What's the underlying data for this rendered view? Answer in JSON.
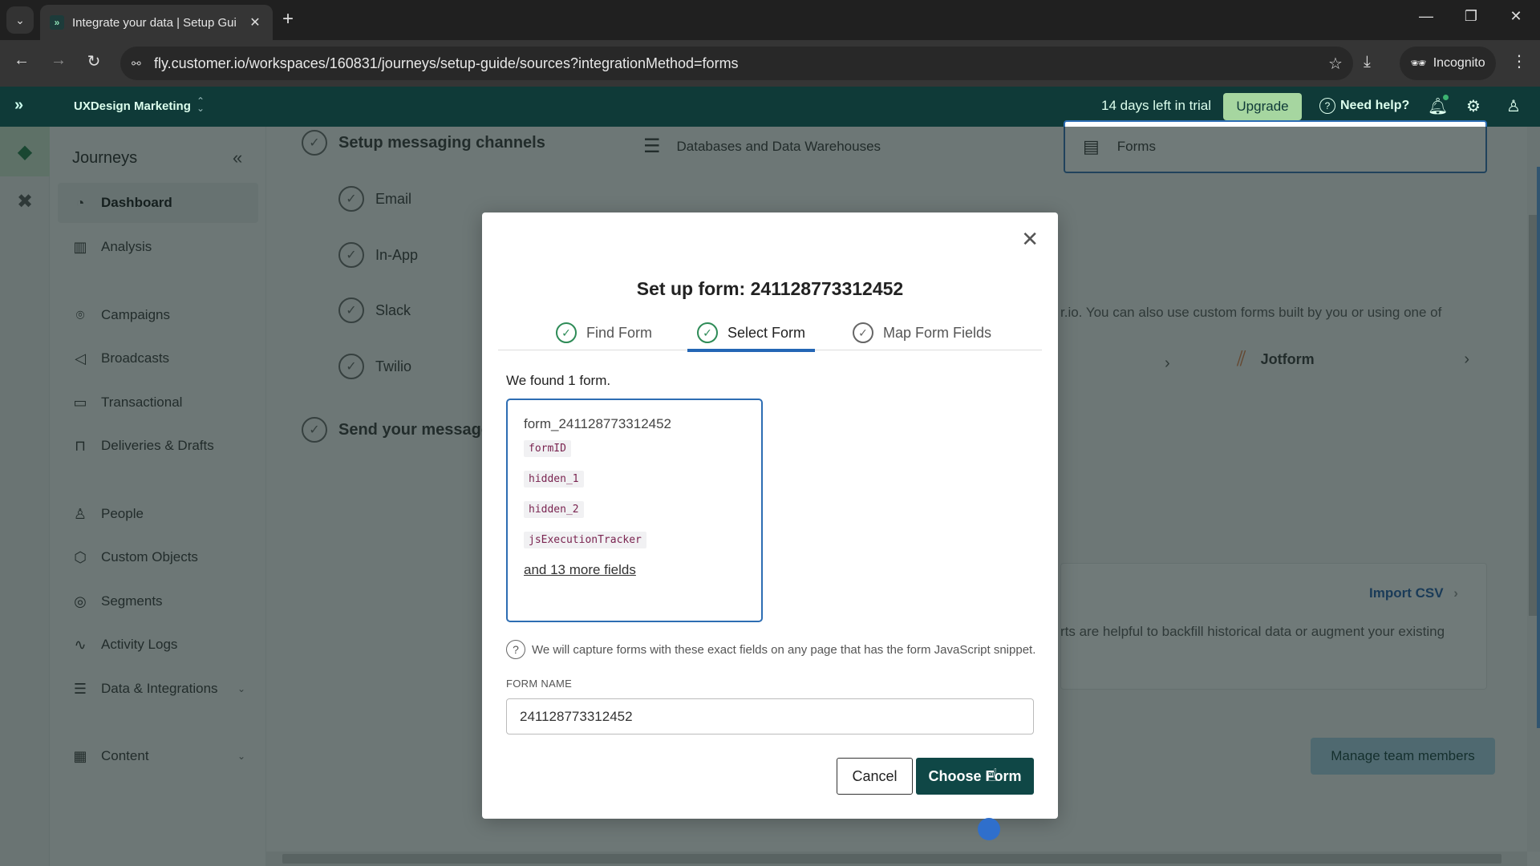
{
  "browser": {
    "tab_title": "Integrate your data | Setup Gui",
    "tab_favicon": "customerio-logo",
    "new_tab": "+",
    "url": "fly.customer.io/workspaces/160831/journeys/setup-guide/sources?integrationMethod=forms",
    "incognito_label": "Incognito",
    "window_controls": {
      "minimize": "—",
      "restore": "❐",
      "close": "✕"
    }
  },
  "topbar": {
    "workspace": "UXDesign Marketing",
    "trial": "14 days left in trial",
    "upgrade": "Upgrade",
    "help": "Need help?"
  },
  "sidebar": {
    "title": "Journeys",
    "items": [
      {
        "label": "Dashboard",
        "icon": "dashboard-icon",
        "glyph": "◔",
        "active": true
      },
      {
        "label": "Analysis",
        "icon": "bar-chart-icon",
        "glyph": "▥"
      },
      {
        "label": "Campaigns",
        "icon": "campaigns-icon",
        "glyph": "⌾"
      },
      {
        "label": "Broadcasts",
        "icon": "megaphone-icon",
        "glyph": "◁"
      },
      {
        "label": "Transactional",
        "icon": "terminal-icon",
        "glyph": "▭"
      },
      {
        "label": "Deliveries & Drafts",
        "icon": "inbox-icon",
        "glyph": "⊓"
      },
      {
        "label": "People",
        "icon": "person-icon",
        "glyph": "♙"
      },
      {
        "label": "Custom Objects",
        "icon": "cube-icon",
        "glyph": "⬡"
      },
      {
        "label": "Segments",
        "icon": "segments-icon",
        "glyph": "◎"
      },
      {
        "label": "Activity Logs",
        "icon": "activity-icon",
        "glyph": "∿"
      },
      {
        "label": "Data & Integrations",
        "icon": "database-icon",
        "glyph": "☰",
        "chevron": "⌄"
      },
      {
        "label": "Content",
        "icon": "layout-icon",
        "glyph": "▦",
        "chevron": "⌄"
      }
    ]
  },
  "background": {
    "steps": [
      {
        "label": "Setup messaging channels",
        "level": "big"
      },
      {
        "label": "Email",
        "level": "small"
      },
      {
        "label": "In-App",
        "level": "small"
      },
      {
        "label": "Slack",
        "level": "small"
      },
      {
        "label": "Twilio",
        "level": "small"
      },
      {
        "label": "Send your message",
        "level": "big"
      }
    ],
    "source_tabs": [
      {
        "label": "Databases and Data Warehouses",
        "icon": "database-icon"
      },
      {
        "label": "Forms",
        "icon": "form-icon"
      }
    ],
    "forms_desc": "r.io. You can also use custom forms built by you or using one of",
    "jotform": "Jotform",
    "import_csv": "Import CSV",
    "import_desc": "rts are helpful to backfill historical data or augment your existing",
    "manage_team": "Manage team members"
  },
  "modal": {
    "title": "Set up form: 241128773312452",
    "steps": [
      {
        "label": "Find Form",
        "state": "done"
      },
      {
        "label": "Select Form",
        "state": "active"
      },
      {
        "label": "Map Form Fields",
        "state": "pending"
      }
    ],
    "found_text": "We found 1 form.",
    "form": {
      "name": "form_241128773312452",
      "fields": [
        "formID",
        "hidden_1",
        "hidden_2",
        "jsExecutionTracker"
      ],
      "more": "and 13 more fields"
    },
    "info": "We will capture forms with these exact fields on any page that has the form JavaScript snippet.",
    "form_name_label": "FORM NAME",
    "form_name_value": "241128773312452",
    "cancel": "Cancel",
    "choose": "Choose Form"
  }
}
